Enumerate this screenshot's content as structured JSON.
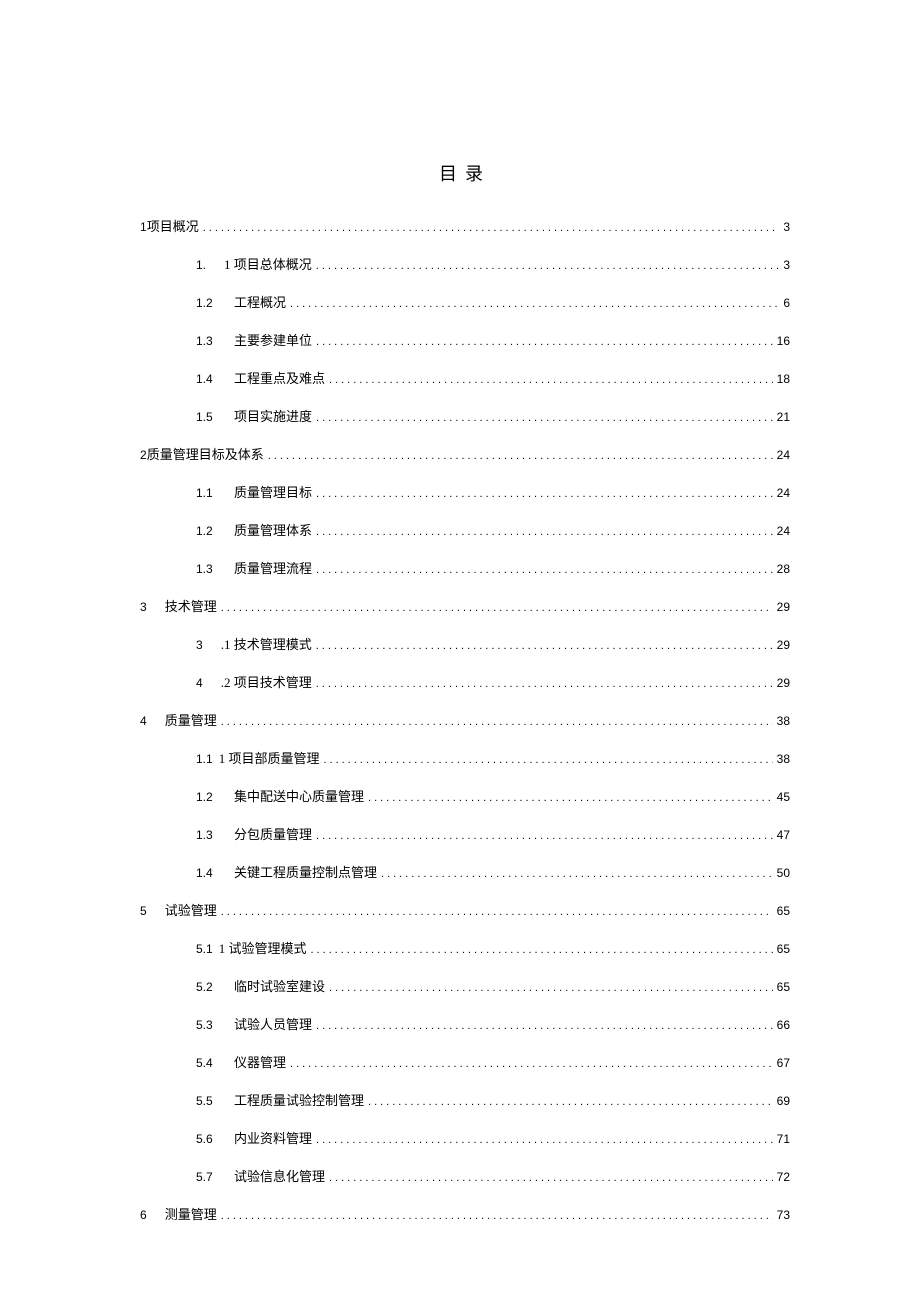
{
  "title": "目录",
  "dots": "..........................................................................................................................................................",
  "entries": [
    {
      "level": 0,
      "num": "1",
      "label": "项目概况",
      "page": "3",
      "tight": true
    },
    {
      "level": 1,
      "num": "1.",
      "label": "1 项目总体概况",
      "page": "3",
      "gap": true
    },
    {
      "level": 1,
      "num": "1.2",
      "label": "工程概况",
      "page": "6",
      "numWide": true
    },
    {
      "level": 1,
      "num": "1.3",
      "label": "主要参建单位",
      "page": "16",
      "numWide": true
    },
    {
      "level": 1,
      "num": "1.4",
      "label": "工程重点及难点",
      "page": "18",
      "numWide": true
    },
    {
      "level": 1,
      "num": "1.5",
      "label": "项目实施进度",
      "page": "21",
      "numWide": true
    },
    {
      "level": 0,
      "num": "2",
      "label": "质量管理目标及体系",
      "page": "24",
      "tight": true
    },
    {
      "level": 1,
      "num": "1.1",
      "label": "质量管理目标",
      "page": "24",
      "numWide": true
    },
    {
      "level": 1,
      "num": "1.2",
      "label": "质量管理体系",
      "page": "24",
      "numWide": true
    },
    {
      "level": 1,
      "num": "1.3",
      "label": "质量管理流程",
      "page": "28",
      "numWide": true
    },
    {
      "level": 0,
      "num": "3",
      "label": "技术管理",
      "page": "29",
      "gap": true
    },
    {
      "level": 1,
      "num": "3",
      "label": ".1 技术管理模式",
      "page": "29",
      "gap": true
    },
    {
      "level": 1,
      "num": "4",
      "label": ".2 项目技术管理",
      "page": "29",
      "gap": true
    },
    {
      "level": 0,
      "num": "4",
      "label": "质量管理",
      "page": "38",
      "gap": true
    },
    {
      "level": 1,
      "num": "1.1",
      "label": "1 项目部质量管理",
      "page": "38"
    },
    {
      "level": 1,
      "num": "1.2",
      "label": "集中配送中心质量管理",
      "page": "45",
      "numWide": true
    },
    {
      "level": 1,
      "num": "1.3",
      "label": "分包质量管理",
      "page": "47",
      "numWide": true
    },
    {
      "level": 1,
      "num": "1.4",
      "label": "关键工程质量控制点管理",
      "page": "50",
      "numWide": true
    },
    {
      "level": 0,
      "num": "5",
      "label": "试验管理",
      "page": "65",
      "gap": true
    },
    {
      "level": 1,
      "num": "5.1",
      "label": "1 试验管理模式",
      "page": "65"
    },
    {
      "level": 1,
      "num": "5.2",
      "label": "临时试验室建设",
      "page": "65",
      "numWide": true
    },
    {
      "level": 1,
      "num": "5.3",
      "label": "试验人员管理",
      "page": "66",
      "numWide": true
    },
    {
      "level": 1,
      "num": "5.4",
      "label": "仪器管理",
      "page": "67",
      "numWide": true
    },
    {
      "level": 1,
      "num": "5.5",
      "label": "工程质量试验控制管理",
      "page": "69",
      "numWide": true
    },
    {
      "level": 1,
      "num": "5.6",
      "label": "内业资料管理",
      "page": "71",
      "numWide": true
    },
    {
      "level": 1,
      "num": "5.7",
      "label": "试验信息化管理",
      "page": "72",
      "numWide": true
    },
    {
      "level": 0,
      "num": "6",
      "label": "测量管理",
      "page": "73",
      "gap": true
    }
  ]
}
